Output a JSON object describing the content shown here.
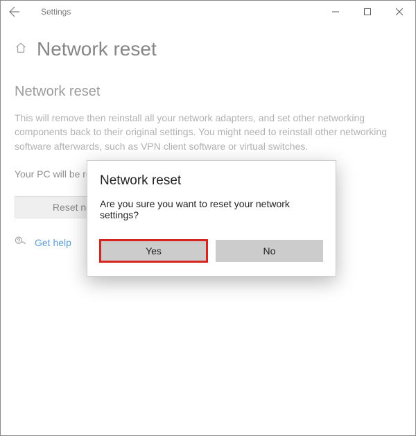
{
  "titlebar": {
    "app_name": "Settings"
  },
  "page": {
    "title": "Network reset",
    "section_title": "Network reset",
    "description": "This will remove then reinstall all your network adapters, and set other networking components back to their original settings. You might need to reinstall other networking software afterwards, such as VPN client software or virtual switches.",
    "restart_note": "Your PC will be restarted.",
    "reset_button": "Reset now",
    "help_link": "Get help"
  },
  "dialog": {
    "title": "Network reset",
    "message": "Are you sure you want to reset your network settings?",
    "yes": "Yes",
    "no": "No"
  }
}
